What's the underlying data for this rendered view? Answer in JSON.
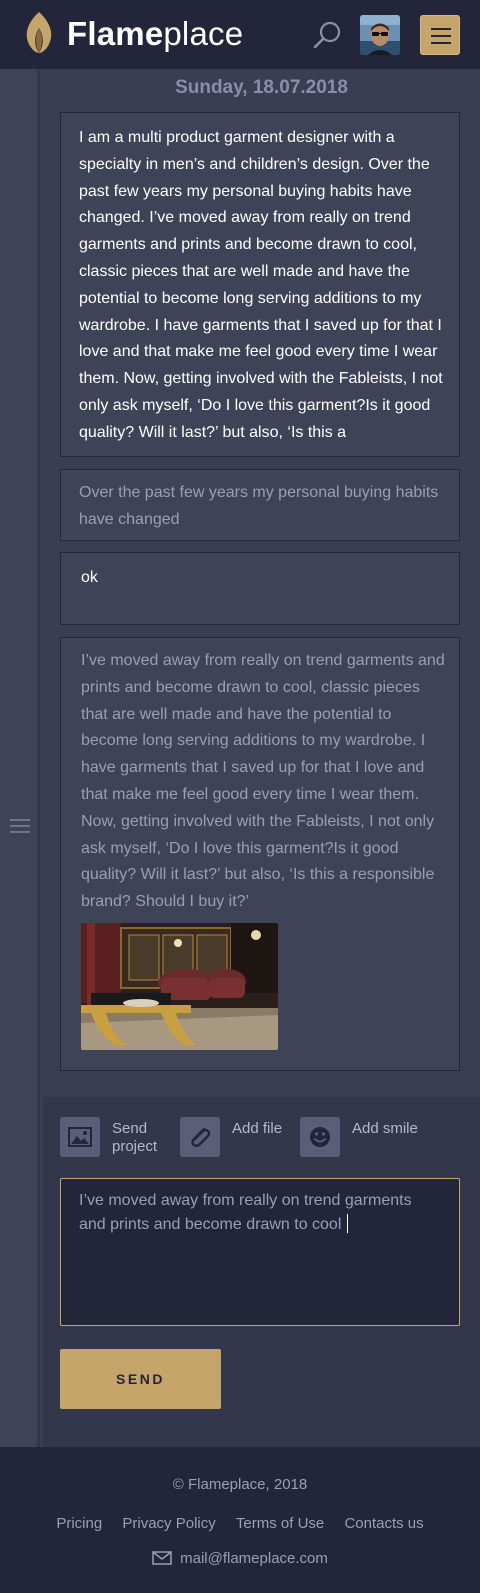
{
  "brand": {
    "name_bold": "Flame",
    "name_light": "place",
    "accent": "#c6a56b"
  },
  "header": {
    "search_icon": "search-icon",
    "menu_icon": "hamburger-icon"
  },
  "chat": {
    "date": "Sunday, 18.07.2018",
    "messages": [
      {
        "text": "I am a multi product garment designer with a specialty in men’s and children’s design. Over the past few years my personal buying habits have changed. I’ve moved away from really on trend garments and prints and become drawn to cool, classic pieces that are well made and have the potential to become long serving additions to my wardrobe. I have garments that I saved up for that I love and that make me feel good every time I wear them. Now, getting involved with the Fableists, I not only ask myself, ‘Do I love this garment?Is it good quality? Will it last?’ but also, ‘Is this a"
      },
      {
        "text": "Over the past few years my personal buying habits have changed"
      },
      {
        "text": "ok"
      },
      {
        "text": "I’ve moved away from really on trend garments and prints and become drawn to cool, classic pieces that are well made and have the potential to become long serving additions to my wardrobe. I have garments that I saved up for that I love and that make me feel good every time I wear them. Now, getting involved with the Fableists, I not only ask myself, ‘Do I love this garment?Is it good quality? Will it last?’ but also, ‘Is this a responsible brand? Should I buy it?’",
        "image": "interior-photo"
      }
    ]
  },
  "composer": {
    "tools": [
      {
        "label": "Send project",
        "icon": "image-icon"
      },
      {
        "label": "Add file",
        "icon": "paperclip-icon"
      },
      {
        "label": "Add smile",
        "icon": "smile-icon"
      }
    ],
    "input_value": "I’ve moved away from really on trend garments and prints and become drawn to cool",
    "send_label": "SEND"
  },
  "footer": {
    "copyright": "© Flameplace, 2018",
    "links": [
      "Pricing",
      "Privacy Policy",
      "Terms of Use",
      "Contacts us"
    ],
    "email": "mail@flameplace.com"
  }
}
